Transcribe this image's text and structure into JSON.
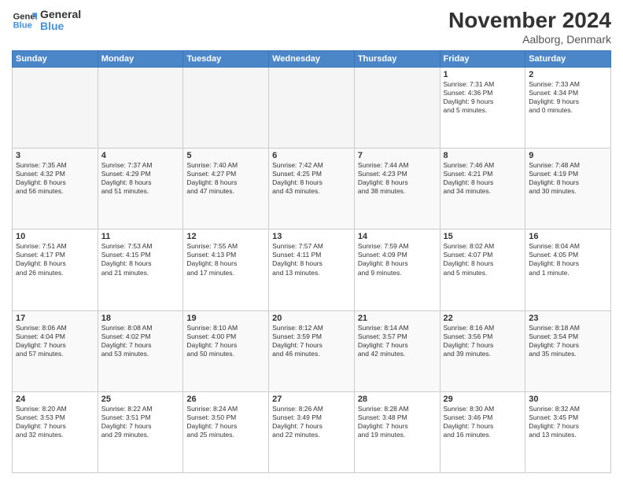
{
  "header": {
    "logo_line1": "General",
    "logo_line2": "Blue",
    "month": "November 2024",
    "location": "Aalborg, Denmark"
  },
  "weekdays": [
    "Sunday",
    "Monday",
    "Tuesday",
    "Wednesday",
    "Thursday",
    "Friday",
    "Saturday"
  ],
  "weeks": [
    [
      {
        "day": "",
        "info": ""
      },
      {
        "day": "",
        "info": ""
      },
      {
        "day": "",
        "info": ""
      },
      {
        "day": "",
        "info": ""
      },
      {
        "day": "",
        "info": ""
      },
      {
        "day": "1",
        "info": "Sunrise: 7:31 AM\nSunset: 4:36 PM\nDaylight: 9 hours\nand 5 minutes."
      },
      {
        "day": "2",
        "info": "Sunrise: 7:33 AM\nSunset: 4:34 PM\nDaylight: 9 hours\nand 0 minutes."
      }
    ],
    [
      {
        "day": "3",
        "info": "Sunrise: 7:35 AM\nSunset: 4:32 PM\nDaylight: 8 hours\nand 56 minutes."
      },
      {
        "day": "4",
        "info": "Sunrise: 7:37 AM\nSunset: 4:29 PM\nDaylight: 8 hours\nand 51 minutes."
      },
      {
        "day": "5",
        "info": "Sunrise: 7:40 AM\nSunset: 4:27 PM\nDaylight: 8 hours\nand 47 minutes."
      },
      {
        "day": "6",
        "info": "Sunrise: 7:42 AM\nSunset: 4:25 PM\nDaylight: 8 hours\nand 43 minutes."
      },
      {
        "day": "7",
        "info": "Sunrise: 7:44 AM\nSunset: 4:23 PM\nDaylight: 8 hours\nand 38 minutes."
      },
      {
        "day": "8",
        "info": "Sunrise: 7:46 AM\nSunset: 4:21 PM\nDaylight: 8 hours\nand 34 minutes."
      },
      {
        "day": "9",
        "info": "Sunrise: 7:48 AM\nSunset: 4:19 PM\nDaylight: 8 hours\nand 30 minutes."
      }
    ],
    [
      {
        "day": "10",
        "info": "Sunrise: 7:51 AM\nSunset: 4:17 PM\nDaylight: 8 hours\nand 26 minutes."
      },
      {
        "day": "11",
        "info": "Sunrise: 7:53 AM\nSunset: 4:15 PM\nDaylight: 8 hours\nand 21 minutes."
      },
      {
        "day": "12",
        "info": "Sunrise: 7:55 AM\nSunset: 4:13 PM\nDaylight: 8 hours\nand 17 minutes."
      },
      {
        "day": "13",
        "info": "Sunrise: 7:57 AM\nSunset: 4:11 PM\nDaylight: 8 hours\nand 13 minutes."
      },
      {
        "day": "14",
        "info": "Sunrise: 7:59 AM\nSunset: 4:09 PM\nDaylight: 8 hours\nand 9 minutes."
      },
      {
        "day": "15",
        "info": "Sunrise: 8:02 AM\nSunset: 4:07 PM\nDaylight: 8 hours\nand 5 minutes."
      },
      {
        "day": "16",
        "info": "Sunrise: 8:04 AM\nSunset: 4:05 PM\nDaylight: 8 hours\nand 1 minute."
      }
    ],
    [
      {
        "day": "17",
        "info": "Sunrise: 8:06 AM\nSunset: 4:04 PM\nDaylight: 7 hours\nand 57 minutes."
      },
      {
        "day": "18",
        "info": "Sunrise: 8:08 AM\nSunset: 4:02 PM\nDaylight: 7 hours\nand 53 minutes."
      },
      {
        "day": "19",
        "info": "Sunrise: 8:10 AM\nSunset: 4:00 PM\nDaylight: 7 hours\nand 50 minutes."
      },
      {
        "day": "20",
        "info": "Sunrise: 8:12 AM\nSunset: 3:59 PM\nDaylight: 7 hours\nand 46 minutes."
      },
      {
        "day": "21",
        "info": "Sunrise: 8:14 AM\nSunset: 3:57 PM\nDaylight: 7 hours\nand 42 minutes."
      },
      {
        "day": "22",
        "info": "Sunrise: 8:16 AM\nSunset: 3:56 PM\nDaylight: 7 hours\nand 39 minutes."
      },
      {
        "day": "23",
        "info": "Sunrise: 8:18 AM\nSunset: 3:54 PM\nDaylight: 7 hours\nand 35 minutes."
      }
    ],
    [
      {
        "day": "24",
        "info": "Sunrise: 8:20 AM\nSunset: 3:53 PM\nDaylight: 7 hours\nand 32 minutes."
      },
      {
        "day": "25",
        "info": "Sunrise: 8:22 AM\nSunset: 3:51 PM\nDaylight: 7 hours\nand 29 minutes."
      },
      {
        "day": "26",
        "info": "Sunrise: 8:24 AM\nSunset: 3:50 PM\nDaylight: 7 hours\nand 25 minutes."
      },
      {
        "day": "27",
        "info": "Sunrise: 8:26 AM\nSunset: 3:49 PM\nDaylight: 7 hours\nand 22 minutes."
      },
      {
        "day": "28",
        "info": "Sunrise: 8:28 AM\nSunset: 3:48 PM\nDaylight: 7 hours\nand 19 minutes."
      },
      {
        "day": "29",
        "info": "Sunrise: 8:30 AM\nSunset: 3:46 PM\nDaylight: 7 hours\nand 16 minutes."
      },
      {
        "day": "30",
        "info": "Sunrise: 8:32 AM\nSunset: 3:45 PM\nDaylight: 7 hours\nand 13 minutes."
      }
    ]
  ]
}
